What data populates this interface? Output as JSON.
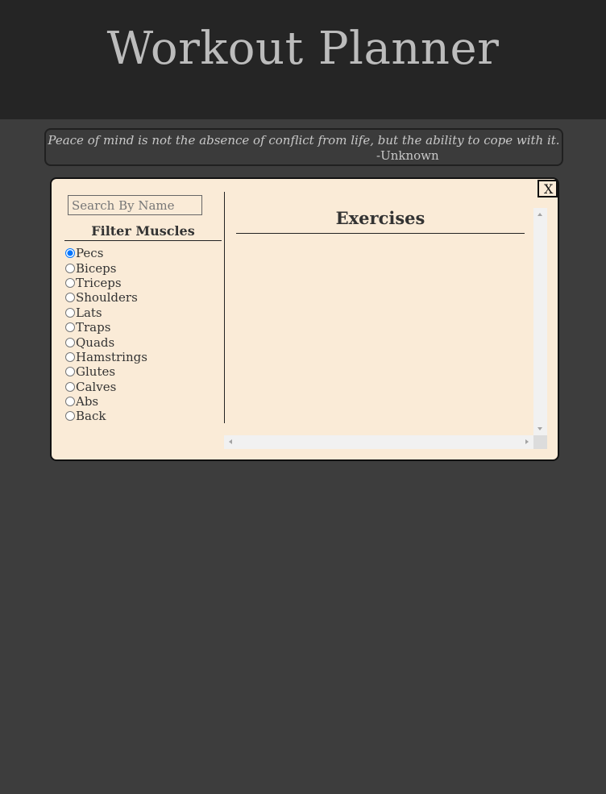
{
  "header": {
    "title": "Workout Planner"
  },
  "quote": {
    "text": "Peace of mind is not the absence of conflict from life, but the ability to cope with it.",
    "author": "-Unknown"
  },
  "modal": {
    "close_label": "X",
    "search": {
      "placeholder": "Search By Name",
      "value": ""
    },
    "filter_title": "Filter Muscles",
    "muscles": [
      {
        "label": "Pecs",
        "checked": true
      },
      {
        "label": "Biceps",
        "checked": false
      },
      {
        "label": "Triceps",
        "checked": false
      },
      {
        "label": "Shoulders",
        "checked": false
      },
      {
        "label": "Lats",
        "checked": false
      },
      {
        "label": "Traps",
        "checked": false
      },
      {
        "label": "Quads",
        "checked": false
      },
      {
        "label": "Hamstrings",
        "checked": false
      },
      {
        "label": "Glutes",
        "checked": false
      },
      {
        "label": "Calves",
        "checked": false
      },
      {
        "label": "Abs",
        "checked": false
      },
      {
        "label": "Back",
        "checked": false
      }
    ],
    "exercises_title": "Exercises",
    "exercises": []
  }
}
